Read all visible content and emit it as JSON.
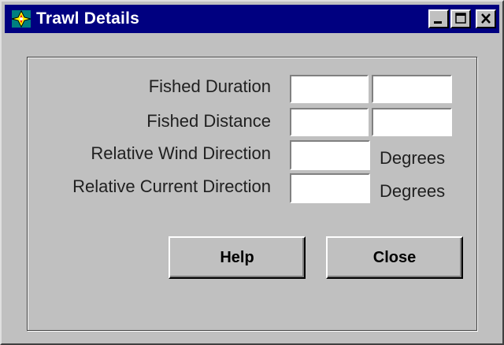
{
  "window": {
    "title": "Trawl Details",
    "icons": {
      "app": "compass-app-icon",
      "minimize": "minimize-icon",
      "maximize": "maximize-icon",
      "close": "close-icon"
    }
  },
  "form": {
    "rows": [
      {
        "label": "Fished Duration",
        "values": [
          "",
          ""
        ]
      },
      {
        "label": "Fished Distance",
        "values": [
          "",
          ""
        ]
      },
      {
        "label": "Relative Wind Direction",
        "values": [
          ""
        ],
        "unit": "Degrees"
      },
      {
        "label": "Relative Current Direction",
        "values": [
          ""
        ],
        "unit": "Degrees"
      }
    ]
  },
  "buttons": {
    "help": "Help",
    "close": "Close"
  },
  "colors": {
    "titlebar": "#000080",
    "face": "#c0c0c0",
    "field": "#ffffff"
  }
}
